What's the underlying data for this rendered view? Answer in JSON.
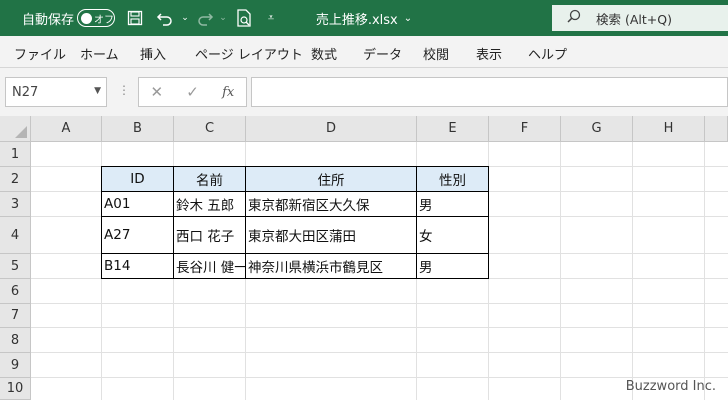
{
  "titlebar": {
    "autosave_label": "自動保存",
    "autosave_toggle": "オフ",
    "doc_title": "売上推移.xlsx",
    "doc_dropdown": "⌄",
    "search_placeholder": "検索 (Alt+Q)",
    "icons": [
      "save-icon",
      "undo-icon",
      "redo-icon",
      "print-preview-icon",
      "customize-quick-access-icon"
    ],
    "color": "#217346"
  },
  "ribbon": {
    "tabs": [
      "ファイル",
      "ホーム",
      "挿入",
      "ページ レイアウト",
      "数式",
      "データ",
      "校閲",
      "表示",
      "ヘルプ"
    ]
  },
  "formula_bar": {
    "name_box": "N27",
    "cancel": "✕",
    "enter": "✓",
    "fx": "fx",
    "formula": ""
  },
  "grid": {
    "columns": [
      "A",
      "B",
      "C",
      "D",
      "E",
      "F",
      "G",
      "H"
    ],
    "rows": [
      "1",
      "2",
      "3",
      "4",
      "5",
      "6",
      "7",
      "8",
      "9",
      "10"
    ]
  },
  "table": {
    "header": [
      "ID",
      "名前",
      "住所",
      "性別"
    ],
    "header_color": "#ddebf7",
    "rows": [
      [
        "A01",
        "鈴木 五郎",
        "東京都新宿区大久保",
        "男"
      ],
      [
        "A27",
        "西口 花子",
        "東京都大田区蒲田",
        "女"
      ],
      [
        "B14",
        "長谷川 健一",
        "神奈川県横浜市鶴見区",
        "男"
      ]
    ]
  },
  "watermark": "Buzzword Inc."
}
